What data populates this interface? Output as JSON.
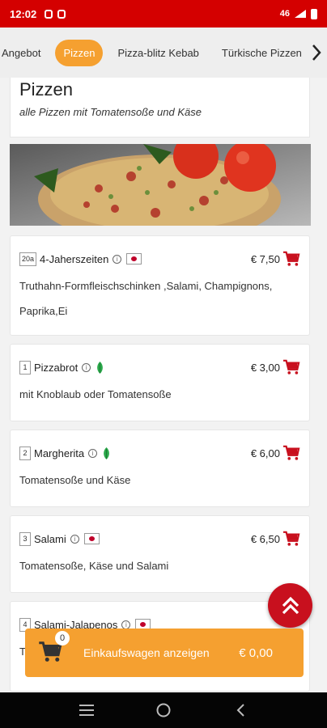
{
  "status": {
    "time": "12:02",
    "right_text": "46"
  },
  "colors": {
    "status_red": "#d40000",
    "accent_orange": "#f5a030",
    "cart_red": "#c8101e"
  },
  "tabs": [
    {
      "label": "Angebot",
      "active": false
    },
    {
      "label": "Pizzen",
      "active": true
    },
    {
      "label": "Pizza-blitz Kebab",
      "active": false
    },
    {
      "label": "Türkische Pizzen",
      "active": false
    }
  ],
  "section": {
    "title": "Pizzen",
    "subtitle": "alle Pizzen mit Tomatensoße und Käse"
  },
  "items": [
    {
      "num": "20a",
      "name": "4-Jaherszeiten",
      "icon": "japan-flag-icon",
      "price": "€ 7,50",
      "desc": "Truthahn-Formfleischschinken ,Salami, Champignons, Paprika,Ei"
    },
    {
      "num": "1",
      "name": "Pizzabrot",
      "icon": "vegetarian-leaf-icon",
      "price": "€ 3,00",
      "desc": "mit Knoblaub oder Tomatensoße"
    },
    {
      "num": "2",
      "name": "Margherita",
      "icon": "vegetarian-leaf-icon",
      "price": "€ 6,00",
      "desc": "Tomatensoße und Käse"
    },
    {
      "num": "3",
      "name": "Salami",
      "icon": "japan-flag-icon",
      "price": "€ 6,50",
      "desc": "Tomatensoße, Käse und Salami"
    },
    {
      "num": "4",
      "name": "Salami-Jalapenos",
      "icon": "japan-flag-icon",
      "price": "",
      "desc": "T"
    }
  ],
  "cart": {
    "count": "0",
    "label": "Einkaufswagen anzeigen",
    "total": "€ 0,00"
  }
}
